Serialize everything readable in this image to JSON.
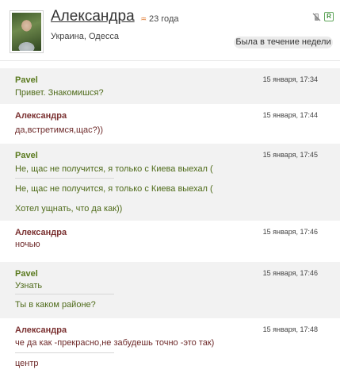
{
  "profile": {
    "name": "Александра",
    "age": "23 года",
    "zodiac_glyph": "♒",
    "location": "Украина, Одесса",
    "status": "Была в течение недели",
    "online_glyph": "R"
  },
  "messages": [
    {
      "author": "Pavel",
      "time": "15 января, 17:34",
      "lines": [
        "Привет. Знакомишся?"
      ]
    },
    {
      "author": "Александра",
      "time": "15 января, 17:44",
      "lines": [
        "да,встретимся,щас?))"
      ]
    },
    {
      "author": "Pavel",
      "time": "15 января, 17:45",
      "lines": [
        "Не, щас не получится, я только с Киева выехал (",
        "Не, щас не получится, я только с Киева выехал (",
        "Хотел ущнать, что да как))"
      ]
    },
    {
      "author": "Александра",
      "time": "15 января, 17:46",
      "lines": [
        "ночью"
      ]
    },
    {
      "author": "Pavel",
      "time": "15 января, 17:46",
      "lines": [
        "Узнать",
        "Ты в каком районе?"
      ]
    },
    {
      "author": "Александра",
      "time": "15 января, 17:48",
      "lines": [
        "че да как -прекрасно,не забудешь точно -это так)",
        "центр"
      ]
    }
  ]
}
